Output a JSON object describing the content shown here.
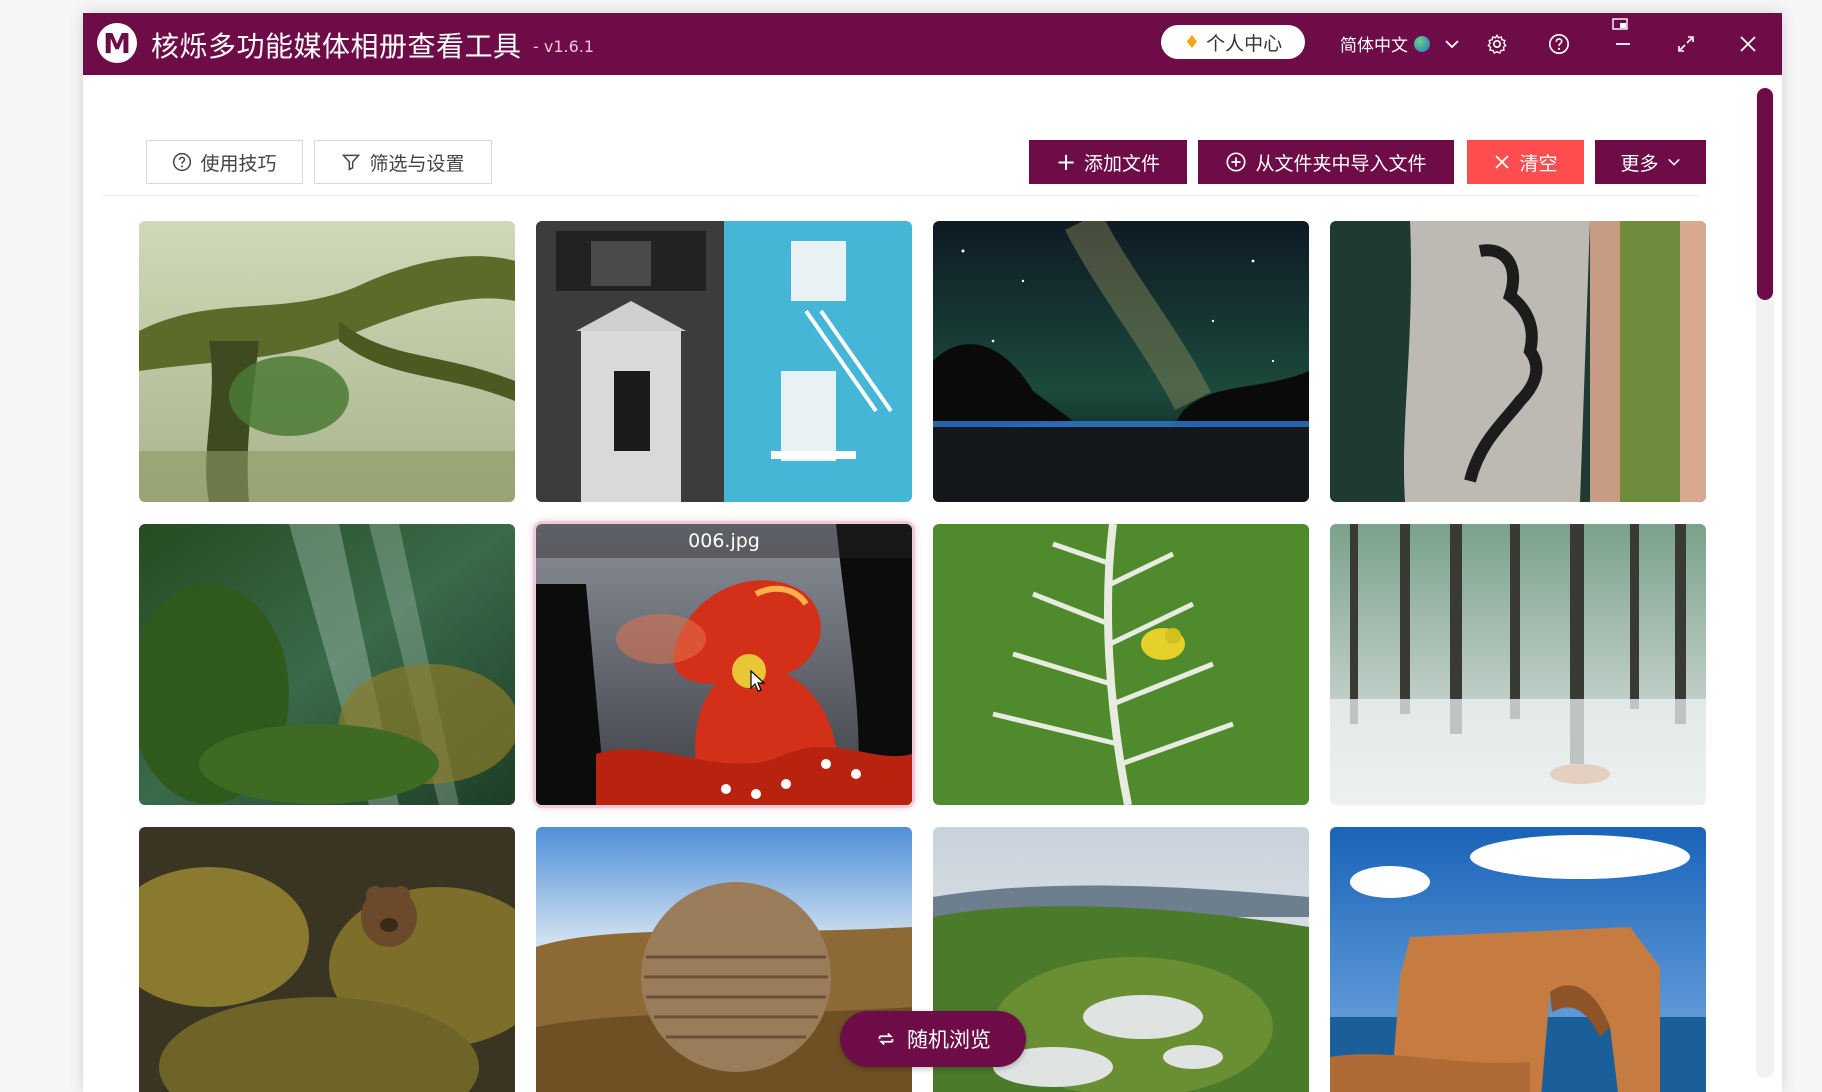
{
  "titlebar": {
    "logo_letter": "M",
    "title": "核烁多功能媒体相册查看工具",
    "version": "- v1.6.1",
    "profile_label": "个人中心",
    "language": "简体中文"
  },
  "toolbar": {
    "tips_label": "使用技巧",
    "filter_label": "筛选与设置",
    "add_file_label": "添加文件",
    "import_folder_label": "从文件夹中导入文件",
    "clear_label": "清空",
    "more_label": "更多"
  },
  "gallery": {
    "selected_caption": "006.jpg",
    "items": [
      {
        "subject": "mossy-tree-forest"
      },
      {
        "subject": "building-facade-blue"
      },
      {
        "subject": "milky-way-night-sky"
      },
      {
        "subject": "aerial-face-sculpture"
      },
      {
        "subject": "underwater-kelp-forest"
      },
      {
        "subject": "red-dragon-lantern"
      },
      {
        "subject": "yellow-bird-on-frost-plant"
      },
      {
        "subject": "snowy-birch-forest"
      },
      {
        "subject": "bear-on-mossy-rocks"
      },
      {
        "subject": "stone-sphere-on-hill"
      },
      {
        "subject": "volcanic-crater-lake"
      },
      {
        "subject": "azure-window-rock-arch"
      }
    ]
  },
  "random_browse_label": "随机浏览",
  "colors": {
    "brand": "#6e0c47",
    "danger": "#ff4d4f",
    "white": "#ffffff"
  }
}
